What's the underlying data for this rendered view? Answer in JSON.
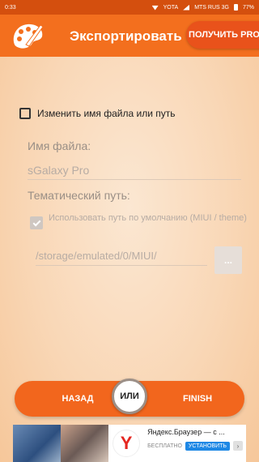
{
  "status_bar": {
    "time": "0:33",
    "carrier1": "YOTA",
    "carrier2": "MTS RUS 3G",
    "battery": "77%"
  },
  "app_bar": {
    "title": "Экспортировать",
    "pro_button": "ПОЛУЧИТЬ PRO",
    "icon": "palette-icon"
  },
  "form": {
    "rename_checkbox_label": "Изменить имя файла или путь",
    "rename_checked": false,
    "file_name_label": "Имя файла:",
    "file_name_value": "sGalaxy Pro",
    "theme_path_label": "Тематический путь:",
    "default_path_label": "Использовать путь по умолчанию (MIUI / theme)",
    "default_path_checked": true,
    "path_value": "/storage/emulated/0/MIUI/",
    "browse_button": "..."
  },
  "bottom_nav": {
    "back": "НАЗАД",
    "or": "ИЛИ",
    "finish": "FINISH"
  },
  "ad": {
    "title": "Яндекс.Браузер — с ...",
    "free": "БЕСПЛАТНО",
    "install": "УСТАНОВИТЬ",
    "logo_letter": "Y"
  },
  "colors": {
    "accent": "#f36f1e",
    "status_bar": "#d44f0e",
    "pro_button": "#e9521b"
  }
}
